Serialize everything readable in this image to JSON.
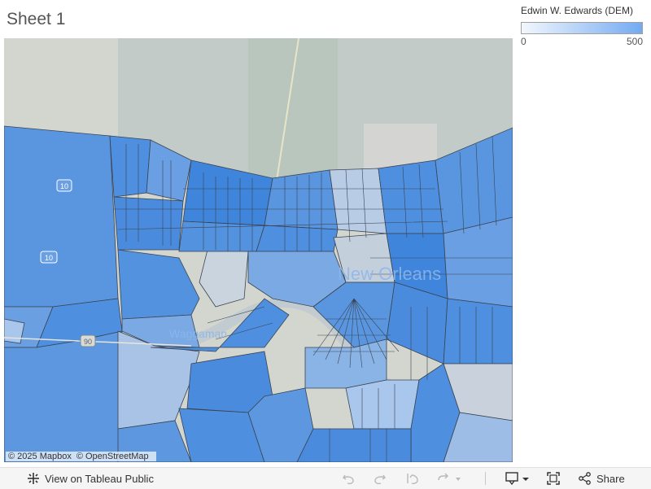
{
  "sheet": {
    "title": "Sheet 1"
  },
  "legend": {
    "title": "Edwin W. Edwards (DEM)",
    "min_label": "0",
    "max_label": "500",
    "color_low": "#f2f7fd",
    "color_high": "#74aaf2"
  },
  "map": {
    "labels": {
      "city": "New Orleans",
      "area": "Waggaman",
      "highway_10": "10",
      "highway_90": "90",
      "highway_10b": "10"
    },
    "attribution": {
      "mapbox": "© 2025 Mapbox",
      "osm": "© OpenStreetMap"
    },
    "colors": {
      "river": "#c7cdd0",
      "land": "#d6d9d2",
      "precinct_fill": "#4f8fdf",
      "precinct_stroke": "#3a4452"
    }
  },
  "toolbar": {
    "view_label": "View on Tableau Public",
    "share_label": "Share",
    "icons": [
      "tableau-logo-icon",
      "undo-icon",
      "redo-icon",
      "revert-icon",
      "refresh-icon",
      "download-icon",
      "fullscreen-icon",
      "share-icon"
    ]
  }
}
